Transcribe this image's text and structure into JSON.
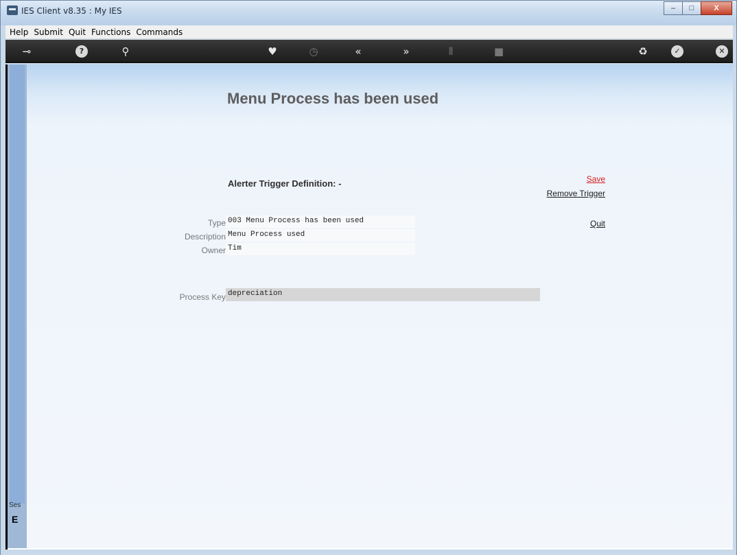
{
  "window": {
    "title": "IES Client v8.35 : My IES",
    "controls": {
      "minimize": "–",
      "maximize": "□",
      "close": "X"
    }
  },
  "menubar": {
    "items": [
      "Help",
      "Submit",
      "Quit",
      "Functions",
      "Commands"
    ]
  },
  "toolbar": {
    "icons": [
      {
        "name": "key-icon",
        "glyph": "⊸"
      },
      {
        "name": "help-icon",
        "glyph": "?"
      },
      {
        "name": "search-icon",
        "glyph": "⚲"
      },
      {
        "name": "heart-icon",
        "glyph": "♥"
      },
      {
        "name": "clock-icon",
        "glyph": "◷"
      },
      {
        "name": "rewind-icon",
        "glyph": "«"
      },
      {
        "name": "forward-icon",
        "glyph": "»"
      },
      {
        "name": "tools-icon",
        "glyph": "⫴"
      },
      {
        "name": "square-icon",
        "glyph": "■"
      },
      {
        "name": "recycle-icon",
        "glyph": "♻"
      },
      {
        "name": "check-icon",
        "glyph": "✓"
      },
      {
        "name": "close-icon",
        "glyph": "✕"
      }
    ]
  },
  "sidebar": {
    "label": "Ses",
    "char": "E"
  },
  "page": {
    "title": "Menu Process has been used",
    "section_title": "Alerter Trigger Definition: -",
    "actions": {
      "save": "Save",
      "remove": "Remove Trigger",
      "quit": "Quit"
    },
    "fields": {
      "type_label": "Type",
      "type_value": "003 Menu Process has been used",
      "description_label": "Description",
      "description_value": "Menu Process used",
      "owner_label": "Owner",
      "owner_value": "Tim",
      "process_key_label": "Process Key",
      "process_key_value": "depreciation"
    }
  }
}
